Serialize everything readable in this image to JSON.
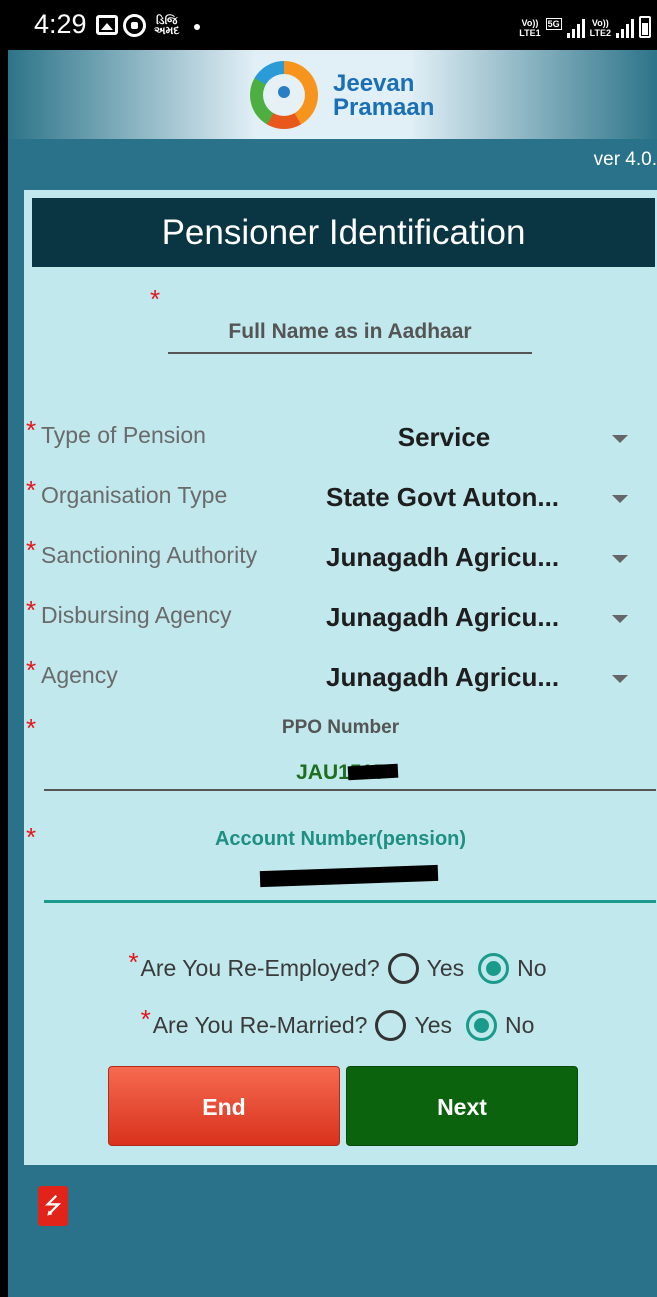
{
  "status_bar": {
    "time": "4:29",
    "app_icon_text": "ડિજિ\nઅમદ",
    "net1": "Vo))\nLTE1",
    "net_5g": "5G",
    "net2": "Vo))\nLTE2"
  },
  "header": {
    "brand_line1": "Jeevan",
    "brand_line2": "Pramaan",
    "version": "ver 4.0."
  },
  "form": {
    "title": "Pensioner Identification",
    "required_mark": "*",
    "full_name_placeholder": "Full Name as in Aadhaar",
    "fields": [
      {
        "label": "Type of Pension",
        "value": "Service"
      },
      {
        "label": "Organisation Type",
        "value": "State Govt Auton..."
      },
      {
        "label": "Sanctioning Authority",
        "value": "Junagadh Agricu..."
      },
      {
        "label": "Disbursing Agency",
        "value": "Junagadh Agricu..."
      },
      {
        "label": "Agency",
        "value": "Junagadh Agricu..."
      }
    ],
    "ppo_label": "PPO Number",
    "ppo_value": "JAU1515",
    "account_label": "Account Number(pension)",
    "re_employed": {
      "question": "Are You Re-Employed?",
      "yes": "Yes",
      "no": "No",
      "selected": "No"
    },
    "re_married": {
      "question": "Are You Re-Married?",
      "yes": "Yes",
      "no": "No",
      "selected": "No"
    },
    "end_label": "End",
    "next_label": "Next"
  },
  "icons": {
    "usb": "usb-icon"
  },
  "colors": {
    "title_bar": "#0a3543",
    "card_bg": "#c0e8ed",
    "end_button": "#e4432a",
    "next_button": "#0b640d",
    "accent": "#1a9a8a"
  }
}
